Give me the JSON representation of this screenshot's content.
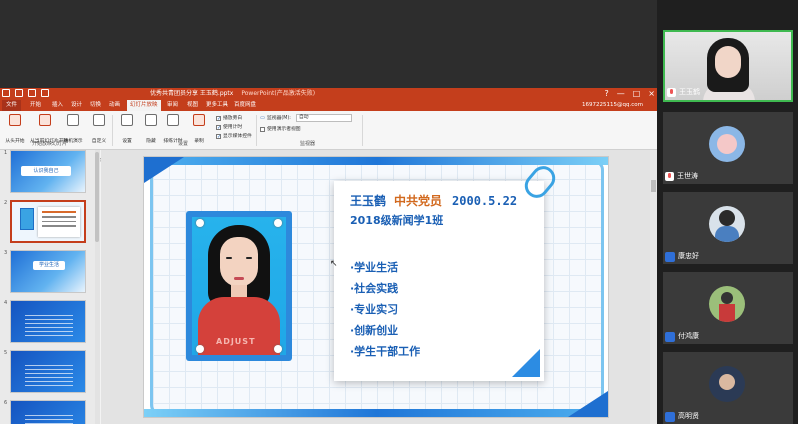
{
  "ppt": {
    "title_file": "优秀共青团员分享 王玉鹤.pptx",
    "title_app": "PowerPoint(产品激活失败)",
    "win_controls": [
      "?",
      "—",
      "□",
      "×"
    ],
    "tabs": [
      "文件",
      "开始",
      "插入",
      "设计",
      "切换",
      "动画",
      "幻灯片放映",
      "审阅",
      "视图",
      "更多工具",
      "百度网盘"
    ],
    "account": "1697225115@qq.com",
    "ribbon": {
      "btn_from_start": "从头开始",
      "btn_from_current": "从当前幻灯片开始",
      "btn_online": "联机演示",
      "btn_custom": "自定义\n幻灯片放映",
      "group_start": "开始放映幻灯片",
      "btn_setup": "设置\n幻灯片放映",
      "btn_hide": "隐藏\n幻灯片",
      "btn_rehearse": "排练计时",
      "btn_record": "录制\n幻灯片演示",
      "chk_narration": "播放旁白",
      "chk_timing": "使用计时",
      "chk_media": "显示媒体控件",
      "group_setup": "设置",
      "monitor_label": "监视器(M):",
      "monitor_value": "自动",
      "chk_presenter": "使用演示者视图",
      "group_monitor": "监视器"
    },
    "thumbs": [
      {
        "num": "1",
        "label": "认识我自己"
      },
      {
        "num": "2",
        "label": ""
      },
      {
        "num": "3",
        "label": "学业生活"
      },
      {
        "num": "4",
        "label": ""
      },
      {
        "num": "5",
        "label": ""
      },
      {
        "num": "6",
        "label": ""
      }
    ],
    "slide": {
      "name": "王玉鹤",
      "party": "中共党员",
      "date": "2000.5.22",
      "class": "2018级新闻学1班",
      "items": [
        "·学业生活",
        "·社会实践",
        "·专业实习",
        "·创新创业",
        "·学生干部工作"
      ],
      "shirt_print": "ADJUST"
    }
  },
  "participants": [
    {
      "name": "王玉鹤",
      "active": true
    },
    {
      "name": "王世涛",
      "active": false
    },
    {
      "name": "康忠好",
      "active": false
    },
    {
      "name": "付鸿康",
      "active": false
    },
    {
      "name": "高明贤",
      "active": false
    }
  ],
  "colors": {
    "ppt_accent": "#c43e1c",
    "slide_blue": "#1a5fb4",
    "slide_orange": "#d2691e",
    "active_speaker": "#3fb950"
  }
}
